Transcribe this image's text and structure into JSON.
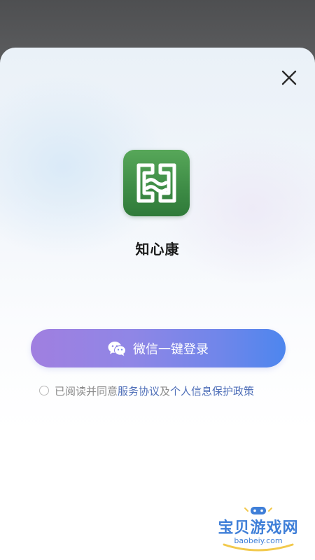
{
  "sheet": {
    "close_icon": "close-icon"
  },
  "app": {
    "icon": "app-logo-icon",
    "name": "知心康"
  },
  "login": {
    "icon": "wechat-icon",
    "label": "微信一键登录"
  },
  "agreement": {
    "prefix": "已阅读并同意",
    "service_link": "服务协议",
    "conjunction": "及",
    "privacy_link": "个人信息保护政策",
    "checked": false
  },
  "watermark": {
    "title": "宝贝游戏网",
    "url": "baobeiy.com"
  },
  "colors": {
    "brand_green": "#3d8b45",
    "button_start": "#a07fe0",
    "button_end": "#4d86ee",
    "link": "#4f6fb8"
  }
}
